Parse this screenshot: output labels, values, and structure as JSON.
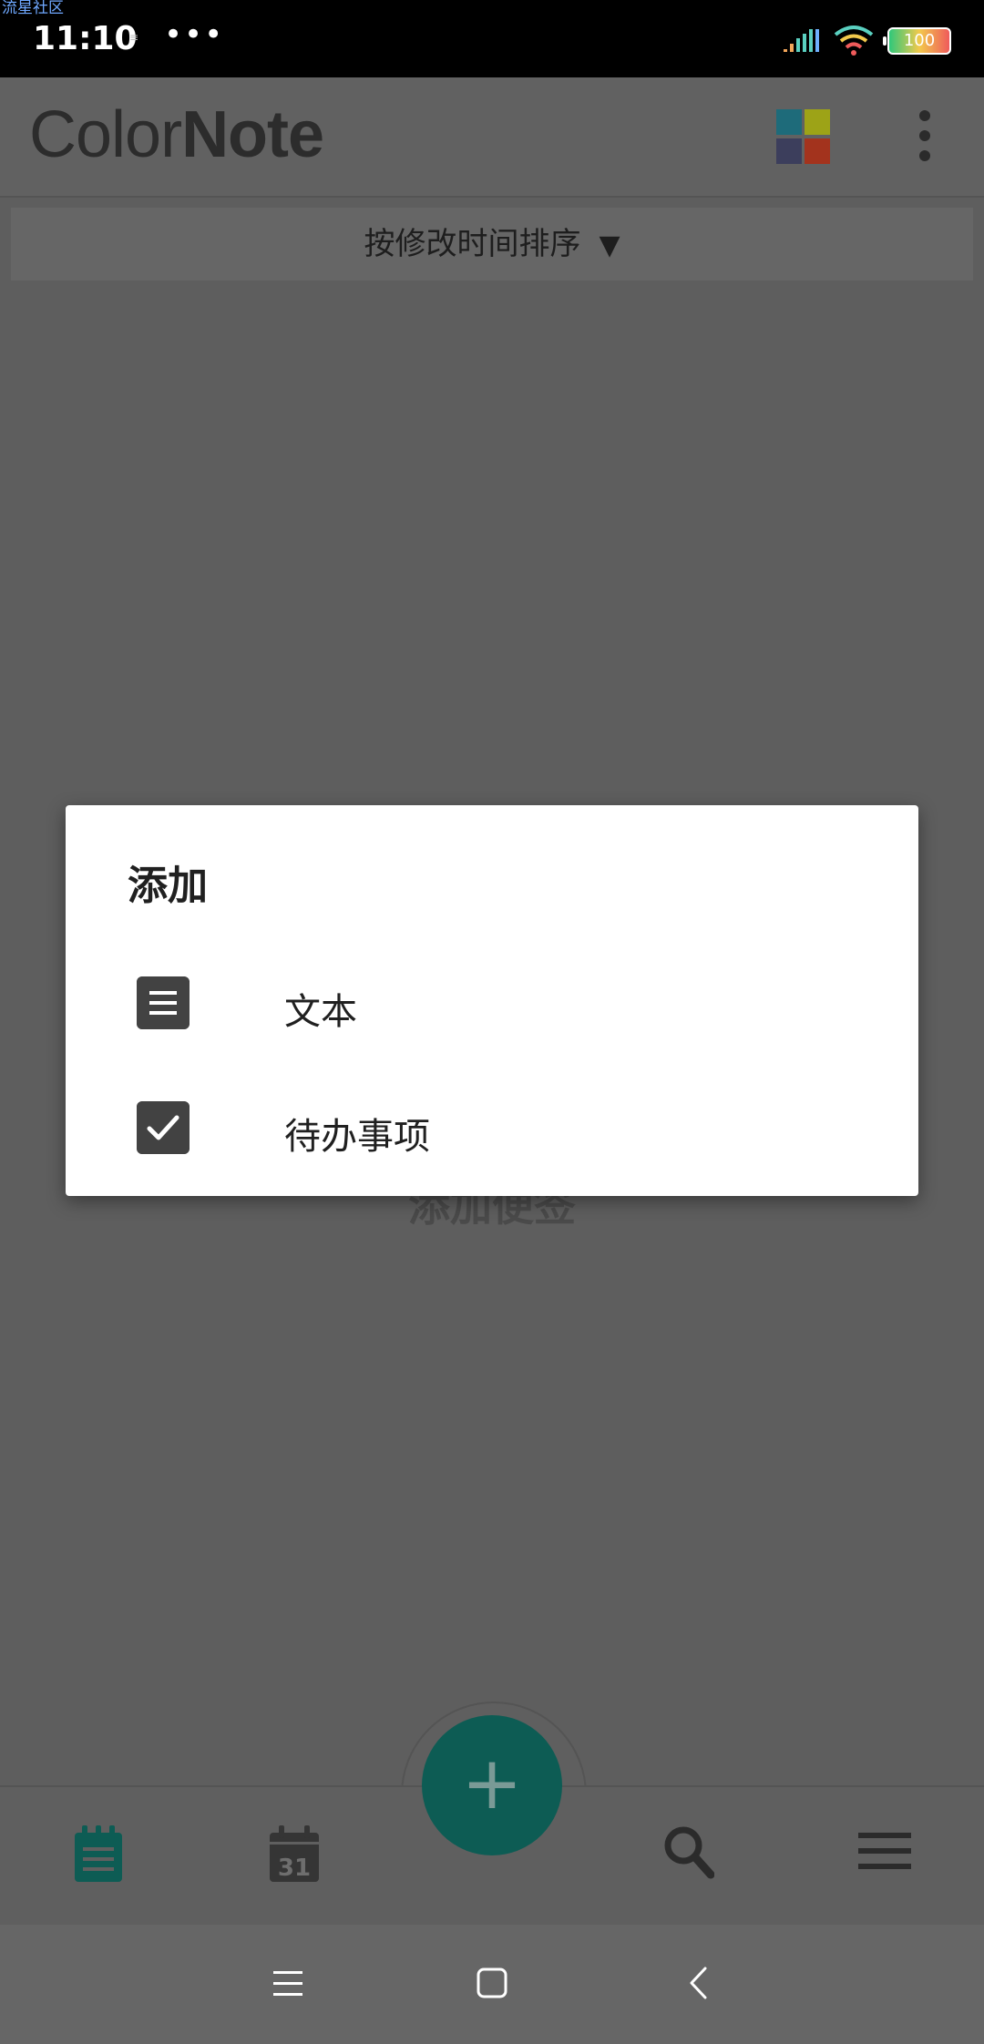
{
  "status_bar": {
    "watermark": "流星社区",
    "time": "11:10",
    "notification_icon": "notification-icon",
    "more_dots": "•••",
    "battery_level": "100"
  },
  "app_bar": {
    "logo_text_color": "Color",
    "logo_text_note": "Note",
    "colors": [
      "#1e6b7a",
      "#9da317",
      "#3c3e5c",
      "#a3331d"
    ],
    "more_icon": "more-vert-icon"
  },
  "sort_bar": {
    "label": "按修改时间排序",
    "arrow": "▼"
  },
  "background": {
    "empty_text": "添加便签"
  },
  "dialog": {
    "title": "添加",
    "options": [
      {
        "label": "文本",
        "icon": "text-note-icon"
      },
      {
        "label": "待办事项",
        "icon": "checklist-icon"
      }
    ]
  },
  "bottom_nav": {
    "items": [
      {
        "icon": "notes-icon",
        "active": true
      },
      {
        "icon": "calendar-icon",
        "text": "31"
      },
      {
        "icon": "search-icon"
      },
      {
        "icon": "menu-icon"
      }
    ],
    "fab_symbol": "+",
    "accent": "#0d5c54"
  },
  "system_nav": {
    "items": [
      "recents-icon",
      "home-icon",
      "back-icon"
    ]
  }
}
